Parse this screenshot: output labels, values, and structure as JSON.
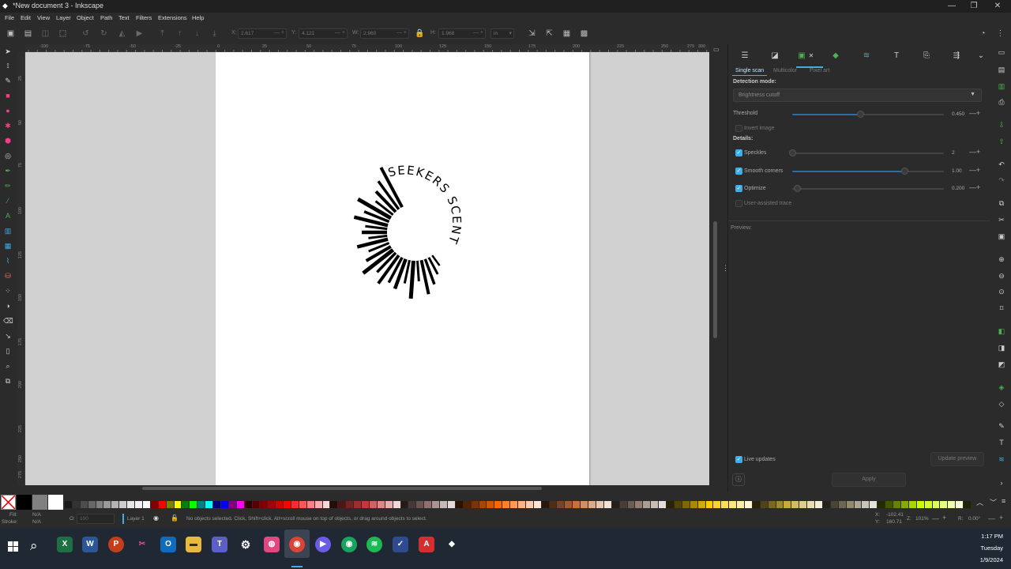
{
  "window": {
    "title": "*New document 3 - Inkscape",
    "minimize": "—",
    "maximize": "❐",
    "close": "✕"
  },
  "menu": [
    "File",
    "Edit",
    "View",
    "Layer",
    "Object",
    "Path",
    "Text",
    "Filters",
    "Extensions",
    "Help"
  ],
  "toolbar": {
    "x_label": "X:",
    "x_value": "2.617",
    "y_label": "Y:",
    "y_value": "4.121",
    "w_label": "W:",
    "w_value": "2.960",
    "h_label": "H:",
    "h_value": "1.968",
    "unit": "in"
  },
  "rulers": {
    "h_ticks": [
      "-100",
      "-75",
      "-50",
      "-25",
      "0",
      "25",
      "50",
      "75",
      "100",
      "125",
      "150",
      "175",
      "200",
      "225",
      "250",
      "275",
      "300"
    ],
    "v_ticks": [
      "25",
      "50",
      "75",
      "100",
      "125",
      "150",
      "175",
      "200",
      "225",
      "250",
      "275"
    ]
  },
  "artwork": {
    "text": "SEEKERS SCENT",
    "color": "#000000"
  },
  "dock": {
    "subtabs": [
      "Single scan",
      "Multicolor",
      "Pixel art"
    ],
    "detection_mode_label": "Detection mode:",
    "detection_mode_value": "Brightness cutoff",
    "threshold": {
      "label": "Threshold",
      "value": "0.450",
      "level": 0.45
    },
    "invert_image": {
      "label": "Invert image",
      "checked": false
    },
    "details_label": "Details:",
    "speckles": {
      "label": "Speckles",
      "value": "2",
      "checked": true,
      "level": 0.0
    },
    "smooth_corners": {
      "label": "Smooth corners",
      "value": "1.00",
      "checked": true,
      "level": 0.74
    },
    "optimize": {
      "label": "Optimize",
      "value": "0.200",
      "checked": true,
      "level": 0.03
    },
    "user_assisted": {
      "label": "User-assisted trace",
      "checked": false
    },
    "preview_label": "Preview:",
    "live_updates": {
      "label": "Live updates",
      "checked": true
    },
    "update_preview": "Update preview",
    "apply": "Apply",
    "minus": "—",
    "plus": "+"
  },
  "status": {
    "fill_label": "Fill:",
    "fill_value": "N/A",
    "stroke_label": "Stroke:",
    "stroke_value": "N/A",
    "opacity_label": "O:",
    "opacity_value": "100",
    "layer": "Layer 1",
    "message": "No objects selected. Click, Shift+click, Alt+scroll mouse on top of objects, or drag around objects to select.",
    "cursor_x_label": "X:",
    "cursor_x": "-102.41",
    "cursor_y_label": "Y:",
    "cursor_y": "160.71",
    "zoom_label": "Z:",
    "zoom": "101%",
    "rotation_label": "R:",
    "rotation": "0.00°"
  },
  "taskbar": {
    "time": "1:17 PM",
    "day": "Tuesday",
    "date": "1/9/2024",
    "apps": [
      "excel",
      "word",
      "powerpoint",
      "snipping-tool",
      "outlook",
      "file-explorer",
      "teams",
      "settings",
      "photos",
      "chrome",
      "video",
      "chrome-profile",
      "spotify",
      "planner",
      "acrobat",
      "inkscape"
    ]
  },
  "palette": [
    "#000000",
    "#808080",
    "#ffffff",
    "#1a1a1a",
    "#333333",
    "#4d4d4d",
    "#666666",
    "#808080",
    "#999999",
    "#b3b3b3",
    "#cccccc",
    "#e6e6e6",
    "#f2f2f2",
    "#ffffff",
    "#800000",
    "#ff0000",
    "#808000",
    "#ffff00",
    "#008000",
    "#00ff00",
    "#008080",
    "#00ffff",
    "#000080",
    "#0000ff",
    "#800080",
    "#ff00ff",
    "#2b0000",
    "#550000",
    "#800000",
    "#aa0000",
    "#d40000",
    "#ff0000",
    "#ff2a2a",
    "#ff5555",
    "#ff8080",
    "#ffaaaa",
    "#ffd5d5",
    "#280b0b",
    "#501616",
    "#782121",
    "#a02c2c",
    "#c83737",
    "#d35f5f",
    "#de8787",
    "#e9afaf",
    "#f4d7d7",
    "#241c1c",
    "#483737",
    "#6c5353",
    "#916f6f",
    "#ac9393",
    "#c8b7b7",
    "#e3dbdb",
    "#2b1100",
    "#552200",
    "#803300",
    "#aa4400",
    "#d45500",
    "#ff6600",
    "#ff7f2a",
    "#ff9955",
    "#ffb380",
    "#ffccaa",
    "#ffe6d5",
    "#28170b",
    "#502d16",
    "#784421",
    "#a05a2c",
    "#c87137",
    "#d38d5f",
    "#deaa87",
    "#e9c6af",
    "#f4e3d7",
    "#241f1c",
    "#483e37",
    "#6c5d53",
    "#917c6f",
    "#ac9d93",
    "#c8beb7",
    "#e3dedb",
    "#2b2200",
    "#554400",
    "#806600",
    "#aa8800",
    "#d4aa00",
    "#ffcc00",
    "#ffd42a",
    "#ffdd55",
    "#ffe680",
    "#ffeeaa",
    "#fff6d5",
    "#28220b",
    "#504416",
    "#786721",
    "#a0892c",
    "#c8ab37",
    "#d3bc5f",
    "#decd87",
    "#e9ddaf",
    "#f4eed7",
    "#24221c",
    "#484537",
    "#6c6753",
    "#918a6f",
    "#aca793",
    "#c8c4b7",
    "#e3e2db",
    "#222b00",
    "#445500",
    "#668000",
    "#88aa00",
    "#aad400",
    "#ccff00",
    "#d4ff2a",
    "#ddff55",
    "#e5ff80",
    "#eeffaa",
    "#f6ffd5",
    "#1c2400"
  ]
}
